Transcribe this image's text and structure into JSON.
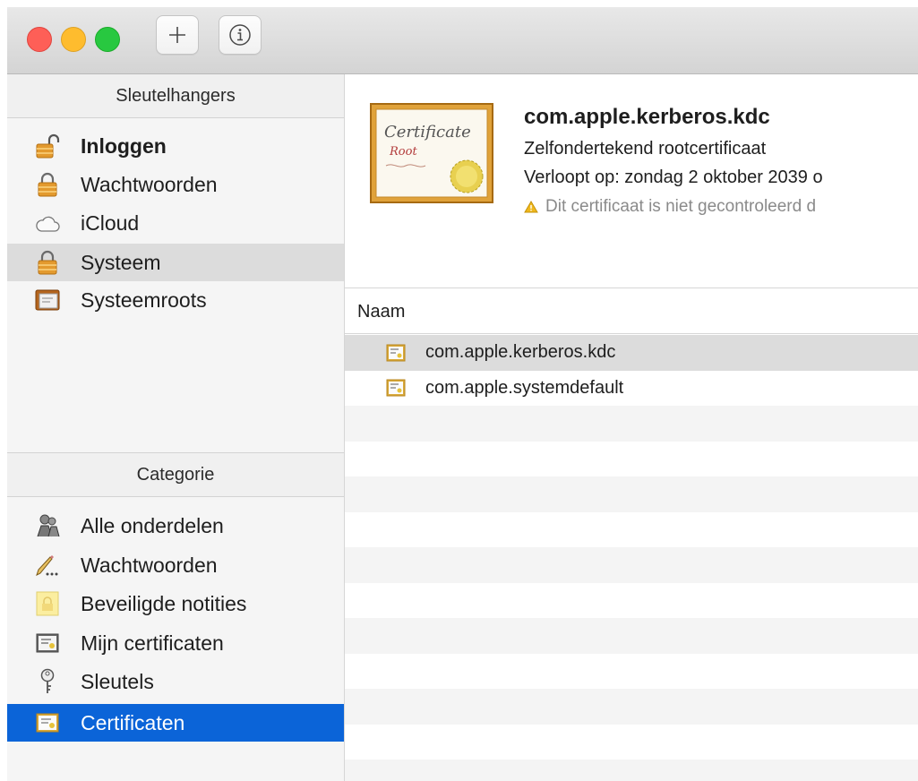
{
  "toolbar": {
    "add_icon": "plus-icon",
    "info_icon": "info-icon"
  },
  "sidebar": {
    "keychains_header": "Sleutelhangers",
    "keychains": [
      {
        "label": "Inloggen",
        "icon": "unlocked-padlock-icon"
      },
      {
        "label": "Wachtwoorden",
        "icon": "padlock-icon"
      },
      {
        "label": "iCloud",
        "icon": "cloud-icon"
      },
      {
        "label": "Systeem",
        "icon": "padlock-icon"
      },
      {
        "label": "Systeemroots",
        "icon": "cabinet-icon"
      }
    ],
    "category_header": "Categorie",
    "categories": [
      {
        "label": "Alle onderdelen",
        "icon": "people-icon"
      },
      {
        "label": "Wachtwoorden",
        "icon": "pencil-icon"
      },
      {
        "label": "Beveiligde notities",
        "icon": "secure-note-icon"
      },
      {
        "label": "Mijn certificaten",
        "icon": "certificate-icon"
      },
      {
        "label": "Sleutels",
        "icon": "key-icon"
      },
      {
        "label": "Certificaten",
        "icon": "certificate-icon"
      }
    ]
  },
  "detail": {
    "image_text_1": "Certificate",
    "image_text_2": "Root",
    "name": "com.apple.kerberos.kdc",
    "subtitle": "Zelfondertekend rootcertificaat",
    "expires": "Verloopt op: zondag 2 oktober 2039 o",
    "warning": "Dit certificaat is niet gecontroleerd d"
  },
  "table": {
    "column_name": "Naam",
    "rows": [
      {
        "name": "com.apple.kerberos.kdc",
        "icon": "certificate-icon"
      },
      {
        "name": "com.apple.systemdefault",
        "icon": "certificate-icon"
      }
    ]
  },
  "colors": {
    "selection_blue": "#0b64d8",
    "selection_gray": "#dcdcdc",
    "close": "#fe5f57",
    "minimize": "#febc2e",
    "zoom": "#28c840"
  }
}
